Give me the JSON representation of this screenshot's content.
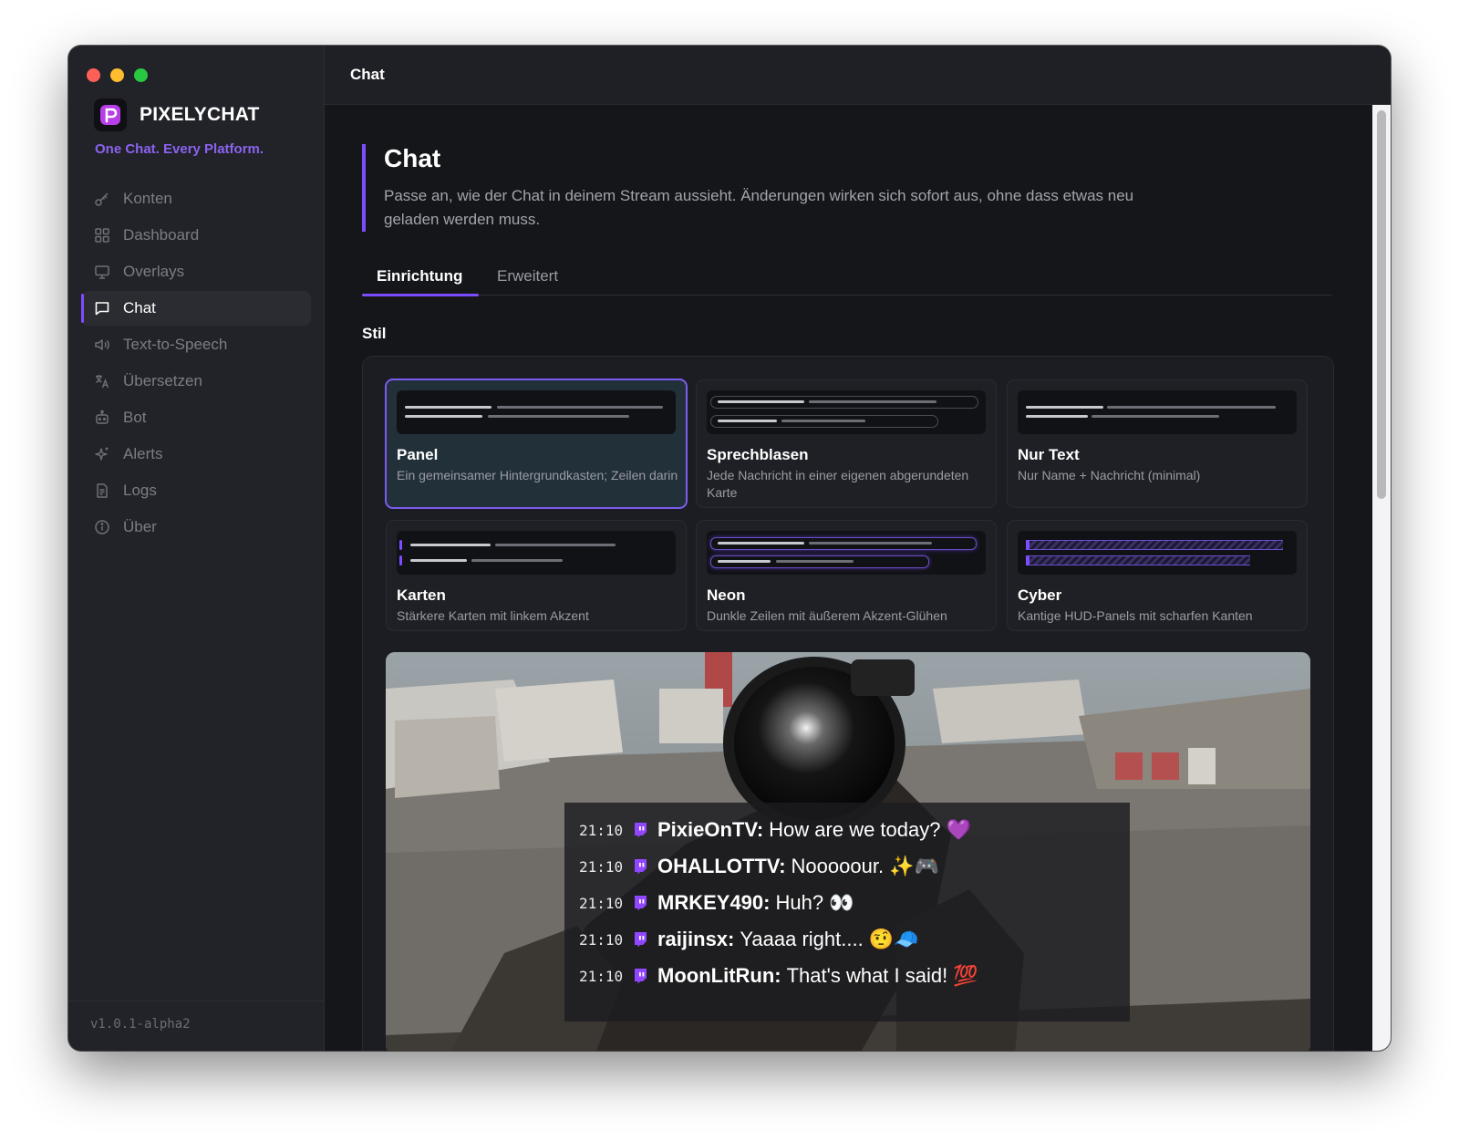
{
  "window": {
    "traffic_lights": {
      "close": "#fe5f57",
      "minimize": "#febc2e",
      "maximize": "#28c840"
    }
  },
  "sidebar": {
    "brand_name": "PIXELYCHAT",
    "tagline": "One Chat. Every Platform.",
    "items": [
      {
        "label": "Konten",
        "icon": "key-icon"
      },
      {
        "label": "Dashboard",
        "icon": "grid-icon"
      },
      {
        "label": "Overlays",
        "icon": "monitor-icon"
      },
      {
        "label": "Chat",
        "icon": "chat-bubble-icon",
        "active": true
      },
      {
        "label": "Text-to-Speech",
        "icon": "speaker-icon"
      },
      {
        "label": "Übersetzen",
        "icon": "translate-icon"
      },
      {
        "label": "Bot",
        "icon": "robot-icon"
      },
      {
        "label": "Alerts",
        "icon": "sparkle-icon"
      },
      {
        "label": "Logs",
        "icon": "document-icon"
      },
      {
        "label": "Über",
        "icon": "info-icon"
      }
    ],
    "version": "v1.0.1-alpha2"
  },
  "topbar": {
    "title": "Chat"
  },
  "page": {
    "title": "Chat",
    "description": "Passe an, wie der Chat in deinem Stream aussieht. Änderungen wirken sich sofort aus, ohne dass etwas neu geladen werden muss.",
    "tabs": [
      {
        "label": "Einrichtung",
        "active": true
      },
      {
        "label": "Erweitert"
      }
    ],
    "section_label": "Stil"
  },
  "styles": [
    {
      "title": "Panel",
      "desc": "Ein gemeinsamer Hintergrundkasten; Zeilen darin",
      "selected": true
    },
    {
      "title": "Sprechblasen",
      "desc": "Jede Nachricht in einer eigenen abgerundeten Karte"
    },
    {
      "title": "Nur Text",
      "desc": "Nur Name + Nachricht (minimal)"
    },
    {
      "title": "Karten",
      "desc": "Stärkere Karten mit linkem Akzent"
    },
    {
      "title": "Neon",
      "desc": "Dunkle Zeilen mit äußerem Akzent-Glühen"
    },
    {
      "title": "Cyber",
      "desc": "Kantige HUD-Panels mit scharfen Kanten"
    }
  ],
  "preview_chat": [
    {
      "time": "21:10",
      "user": "PixieOnTV:",
      "text": "How are we today? 💜",
      "platform_icon": "twitch-icon"
    },
    {
      "time": "21:10",
      "user": "OHALLOTTV:",
      "text": "Nooooour. ✨🎮",
      "platform_icon": "twitch-icon"
    },
    {
      "time": "21:10",
      "user": "MRKEY490:",
      "text": "Huh? 👀",
      "platform_icon": "twitch-icon"
    },
    {
      "time": "21:10",
      "user": "raijinsx:",
      "text": "Yaaaa right.... 🤨🧢",
      "platform_icon": "twitch-icon"
    },
    {
      "time": "21:10",
      "user": "MoonLitRun:",
      "text": "That's what I said! 💯",
      "platform_icon": "twitch-icon"
    }
  ],
  "colors": {
    "accent": "#7c4dff",
    "twitch": "#9146ff",
    "background": "#15161a"
  }
}
